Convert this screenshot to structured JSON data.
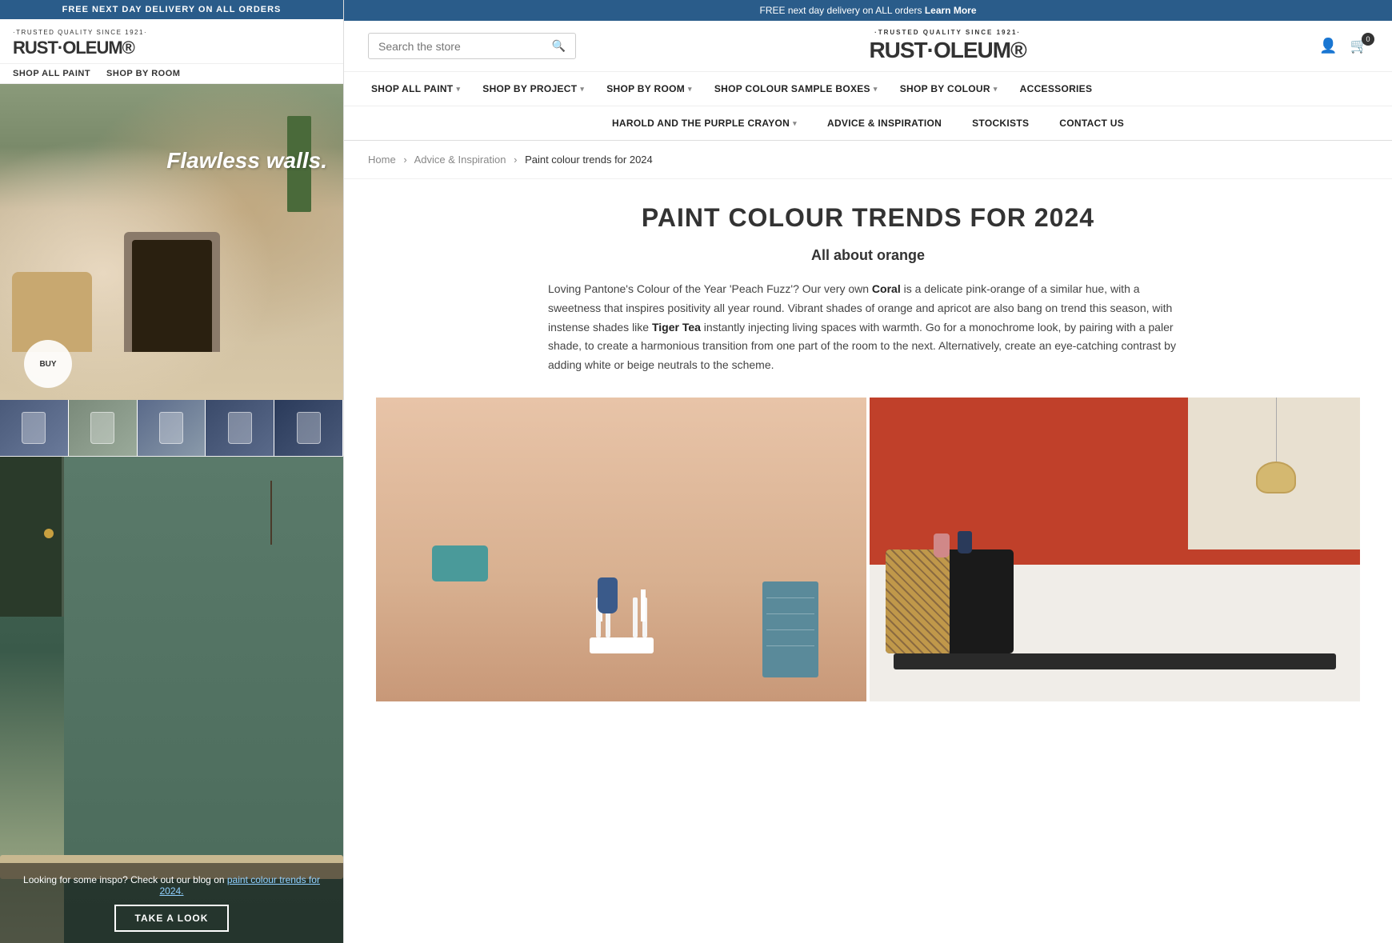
{
  "left": {
    "top_bar": "FREE NEXT DAY DELIVERY ON ALL ORDERS",
    "logo_trusted": "·TRUSTED QUALITY SINCE 1921·",
    "logo_name": "RUST·OLEUM®",
    "nav_items": [
      "SHOP ALL PAINT",
      "SHOP BY ROOM"
    ],
    "hero_text": "Flawless walls.",
    "hero_btn": "BUY",
    "bottom_text": "Looking for some inspo? Check out our blog on ",
    "bottom_link_text": "paint colour trends for 2024.",
    "bottom_cta": "TAKE A LOOK"
  },
  "right": {
    "top_bar_text": "FREE next day delivery on ALL orders ",
    "top_bar_link": "Learn More",
    "search_placeholder": "Search the store",
    "logo_trusted": "·TRUSTED QUALITY SINCE 1921·",
    "logo_name": "RUST·OLEUM®",
    "nav_main": [
      {
        "label": "SHOP ALL PAINT",
        "has_dropdown": true
      },
      {
        "label": "SHOP BY PROJECT",
        "has_dropdown": true
      },
      {
        "label": "SHOP BY ROOM",
        "has_dropdown": true
      },
      {
        "label": "SHOP COLOUR SAMPLE BOXES",
        "has_dropdown": true
      },
      {
        "label": "SHOP BY COLOUR",
        "has_dropdown": true
      },
      {
        "label": "ACCESSORIES",
        "has_dropdown": false
      }
    ],
    "nav_bottom": [
      {
        "label": "HAROLD AND THE PURPLE CRAYON",
        "has_dropdown": true
      },
      {
        "label": "ADVICE & INSPIRATION",
        "has_dropdown": false
      },
      {
        "label": "STOCKISTS",
        "has_dropdown": false
      },
      {
        "label": "CONTACT US",
        "has_dropdown": false
      }
    ],
    "breadcrumb": {
      "home": "Home",
      "sep1": "›",
      "section": "Advice & Inspiration",
      "sep2": "›",
      "current": "Paint colour trends for 2024"
    },
    "article": {
      "title": "PAINT COLOUR TRENDS FOR 2024",
      "subtitle": "All about orange",
      "body_1": "Loving Pantone's Colour of the Year 'Peach Fuzz'? Our very own ",
      "body_bold_1": "Coral",
      "body_2": " is a delicate pink-orange of a similar hue, with a sweetness that inspires positivity all year round. Vibrant shades of orange and apricot are also bang on trend this season, with instense shades like ",
      "body_bold_2": "Tiger Tea",
      "body_3": " instantly injecting living spaces with warmth. Go for a monochrome look, by pairing with a paler shade, to create a harmonious transition from one part of the room to the next. Alternatively, create an eye-catching contrast by adding white or beige neutrals to the scheme."
    },
    "cart_count": "0"
  }
}
